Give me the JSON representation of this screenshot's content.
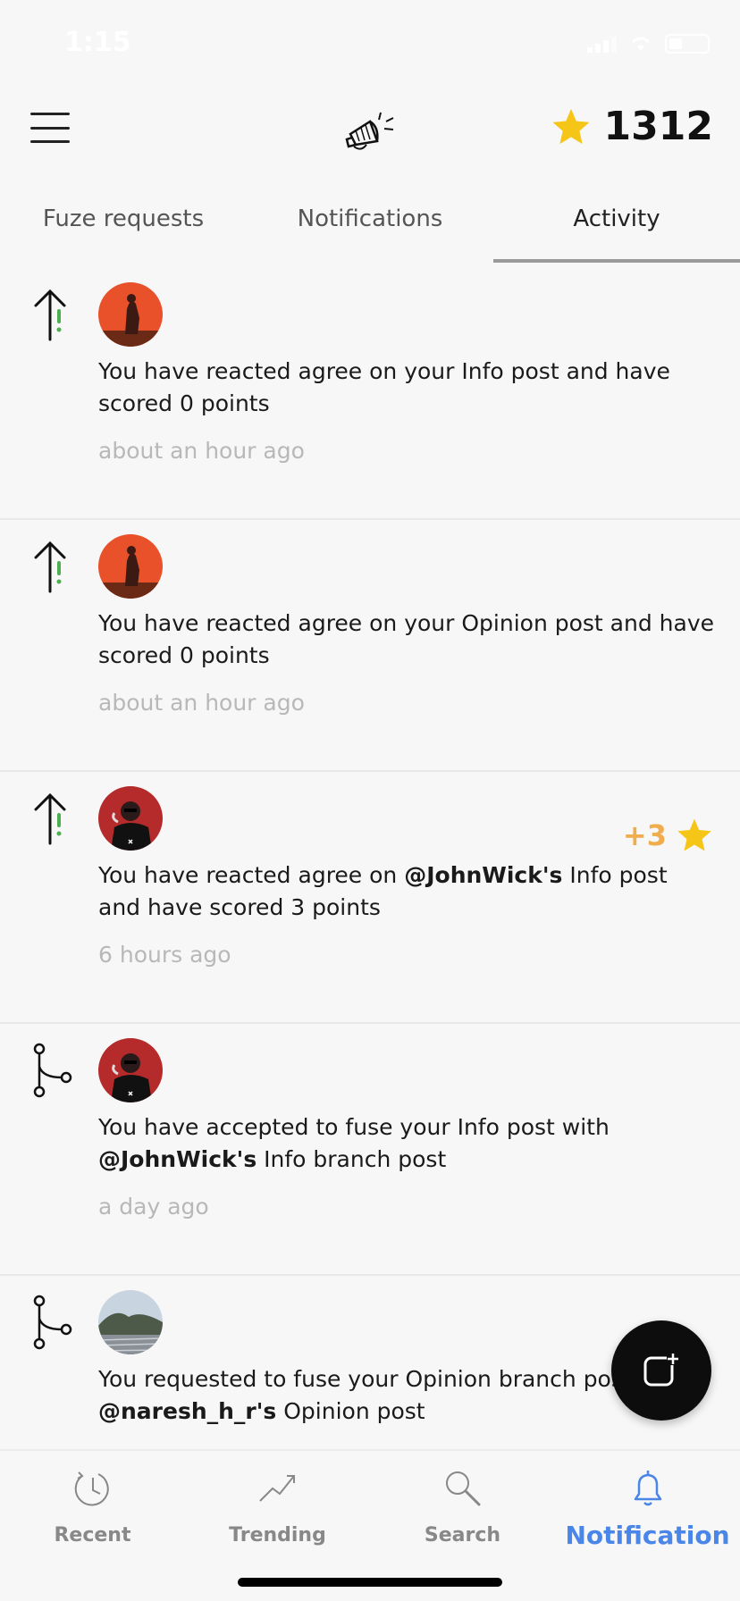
{
  "status_bar": {
    "time": "1:15"
  },
  "header": {
    "score": "1312"
  },
  "tabs": [
    {
      "label": "Fuze requests",
      "active": false
    },
    {
      "label": "Notifications",
      "active": false
    },
    {
      "label": "Activity",
      "active": true
    }
  ],
  "activity": [
    {
      "icon": "agree-arrow-icon",
      "avatar": "avatar-warrior-sunset",
      "text_before": "You have reacted agree on your Info post and have scored 0 points",
      "mention": "",
      "text_after": "",
      "time": "about an hour ago",
      "points": ""
    },
    {
      "icon": "agree-arrow-icon",
      "avatar": "avatar-warrior-sunset",
      "text_before": "You have reacted agree on your Opinion post and have scored 0 points",
      "mention": "",
      "text_after": "",
      "time": "about an hour ago",
      "points": ""
    },
    {
      "icon": "agree-arrow-icon",
      "avatar": "avatar-johnwick",
      "text_before": "You have reacted agree on ",
      "mention": "@JohnWick's",
      "text_after": " Info post and have scored 3 points",
      "time": "6 hours ago",
      "points": "+3"
    },
    {
      "icon": "fuse-branch-icon",
      "avatar": "avatar-johnwick",
      "text_before": "You have accepted to fuse your Info post with ",
      "mention": "@JohnWick's",
      "text_after": " Info branch post",
      "time": "a day ago",
      "points": ""
    },
    {
      "icon": "fuse-branch-icon",
      "avatar": "avatar-landscape",
      "text_before": "You requested to fuse your Opinion branch post to ",
      "mention": "@naresh_h_r's",
      "text_after": " Opinion post",
      "time": "",
      "points": ""
    }
  ],
  "bottom_nav": [
    {
      "label": "Recent",
      "icon": "clock-icon",
      "active": false
    },
    {
      "label": "Trending",
      "icon": "trending-icon",
      "active": false
    },
    {
      "label": "Search",
      "icon": "search-icon",
      "active": false
    },
    {
      "label": "Notification",
      "icon": "bell-icon",
      "active": true
    }
  ],
  "colors": {
    "accent": "#4a86e8",
    "points": "#f0ad4e",
    "star": "#f5c518",
    "agree_green": "#4caf50"
  }
}
